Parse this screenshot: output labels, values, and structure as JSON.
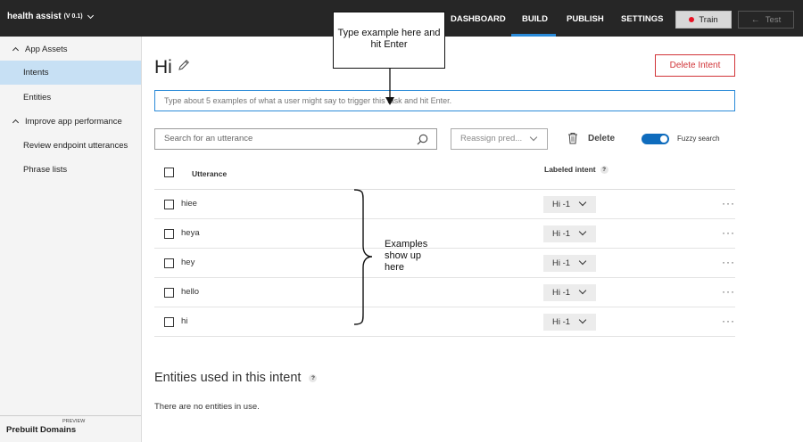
{
  "topbar": {
    "app_name": "health assist",
    "version": "(V 0.1)",
    "nav": [
      "DASHBOARD",
      "BUILD",
      "PUBLISH",
      "SETTINGS"
    ],
    "active_nav": "BUILD",
    "train_label": "Train",
    "test_label": "Test",
    "accent_color": "#2a8ad8",
    "train_status_color": "#e81123"
  },
  "sidebar": {
    "section1": "App Assets",
    "items1": [
      "Intents",
      "Entities"
    ],
    "section2": "Improve app performance",
    "items2": [
      "Review endpoint utterances",
      "Phrase lists"
    ],
    "selected": "Intents",
    "prebuilt": "Prebuilt Domains",
    "prebuilt_badge": "PREVIEW"
  },
  "main": {
    "intent_name": "Hi",
    "delete_intent_label": "Delete Intent",
    "utterance_placeholder": "Type about 5 examples of what a user might say to trigger this task and hit Enter.",
    "search_placeholder": "Search for an utterance",
    "reassign_label": "Reassign pred...",
    "delete_label": "Delete",
    "fuzzy_label": "Fuzzy search",
    "fuzzy_on": true,
    "table": {
      "col_utterance": "Utterance",
      "col_intent": "Labeled intent",
      "col_intent_help": "?",
      "rows": [
        {
          "text": "hiee",
          "intent": "Hi -1"
        },
        {
          "text": "heya",
          "intent": "Hi -1"
        },
        {
          "text": "hey",
          "intent": "Hi -1"
        },
        {
          "text": "hello",
          "intent": "Hi -1"
        },
        {
          "text": "hi",
          "intent": "Hi -1"
        }
      ],
      "more_glyph": "···"
    },
    "entities_title": "Entities used in this intent",
    "entities_help": "?",
    "entities_empty": "There are no entities in use."
  },
  "annotations": {
    "callout": "Type example here and hit Enter",
    "examples_note": "Examples show up here"
  }
}
